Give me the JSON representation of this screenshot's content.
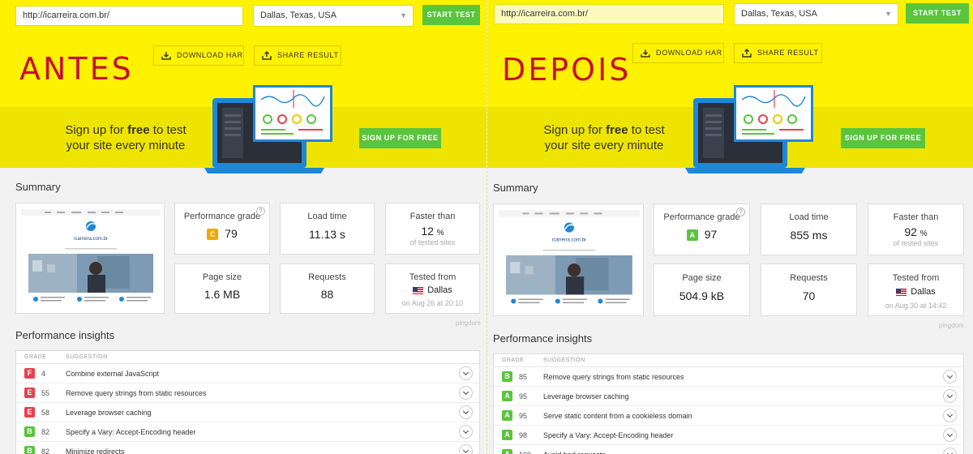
{
  "before": {
    "label": "ANTES",
    "url": "http://icarreira.com.br/",
    "location": "Dallas, Texas, USA",
    "start_test": "START TEST",
    "download_har": "DOWNLOAD HAR",
    "share_result": "SHARE RESULT",
    "promo_line1_a": "Sign up for ",
    "promo_line1_b": "free",
    "promo_line1_c": " to test",
    "promo_line2": "your site every minute",
    "sign_up": "SIGN UP FOR FREE",
    "summary_title": "Summary",
    "perf_grade_label": "Performance grade",
    "perf_grade_letter": "C",
    "perf_grade_color": "#f0a800",
    "perf_grade_value": "79",
    "load_time_label": "Load time",
    "load_time_value": "11.13 s",
    "faster_label": "Faster than",
    "faster_value": "12",
    "faster_unit": "%",
    "faster_sub": "of tested sites",
    "page_size_label": "Page size",
    "page_size_value": "1.6 MB",
    "requests_label": "Requests",
    "requests_value": "88",
    "tested_label": "Tested from",
    "tested_city": "Dallas",
    "tested_date": "on Aug 26 at 20:10",
    "pingdom": "pingdom",
    "insights_title": "Performance insights",
    "col_grade": "GRADE",
    "col_suggestion": "SUGGESTION",
    "rows": [
      {
        "grade": "F",
        "score": "4",
        "text": "Combine external JavaScript",
        "color": "#e8414e"
      },
      {
        "grade": "E",
        "score": "55",
        "text": "Remove query strings from static resources",
        "color": "#e8414e"
      },
      {
        "grade": "E",
        "score": "58",
        "text": "Leverage browser caching",
        "color": "#e8414e"
      },
      {
        "grade": "B",
        "score": "82",
        "text": "Specify a Vary: Accept-Encoding header",
        "color": "#5ac43c"
      },
      {
        "grade": "B",
        "score": "82",
        "text": "Minimize redirects",
        "color": "#5ac43c"
      }
    ]
  },
  "after": {
    "label": "DEPOIS",
    "url": "http://icarreira.com.br/",
    "location": "Dallas, Texas, USA",
    "start_test": "START TEST",
    "download_har": "DOWNLOAD HAR",
    "share_result": "SHARE RESULT",
    "promo_line1_a": "Sign up for ",
    "promo_line1_b": "free",
    "promo_line1_c": " to test",
    "promo_line2": "your site every minute",
    "sign_up": "SIGN UP FOR FREE",
    "summary_title": "Summary",
    "perf_grade_label": "Performance grade",
    "perf_grade_letter": "A",
    "perf_grade_color": "#5ac43c",
    "perf_grade_value": "97",
    "load_time_label": "Load time",
    "load_time_value": "855 ms",
    "faster_label": "Faster than",
    "faster_value": "92",
    "faster_unit": "%",
    "faster_sub": "of tested sites",
    "page_size_label": "Page size",
    "page_size_value": "504.9 kB",
    "requests_label": "Requests",
    "requests_value": "70",
    "tested_label": "Tested from",
    "tested_city": "Dallas",
    "tested_date": "on Aug 30 at 14:42",
    "pingdom": "pingdom",
    "insights_title": "Performance insights",
    "col_grade": "GRADE",
    "col_suggestion": "SUGGESTION",
    "rows": [
      {
        "grade": "B",
        "score": "85",
        "text": "Remove query strings from static resources",
        "color": "#5ac43c"
      },
      {
        "grade": "A",
        "score": "95",
        "text": "Leverage browser caching",
        "color": "#5ac43c"
      },
      {
        "grade": "A",
        "score": "95",
        "text": "Serve static content from a cookieless domain",
        "color": "#5ac43c"
      },
      {
        "grade": "A",
        "score": "98",
        "text": "Specify a Vary: Accept-Encoding header",
        "color": "#5ac43c"
      },
      {
        "grade": "A",
        "score": "100",
        "text": "Avoid bad requests",
        "color": "#5ac43c"
      }
    ]
  },
  "thumbnail": {
    "site_name": "icarreira.com.br"
  }
}
